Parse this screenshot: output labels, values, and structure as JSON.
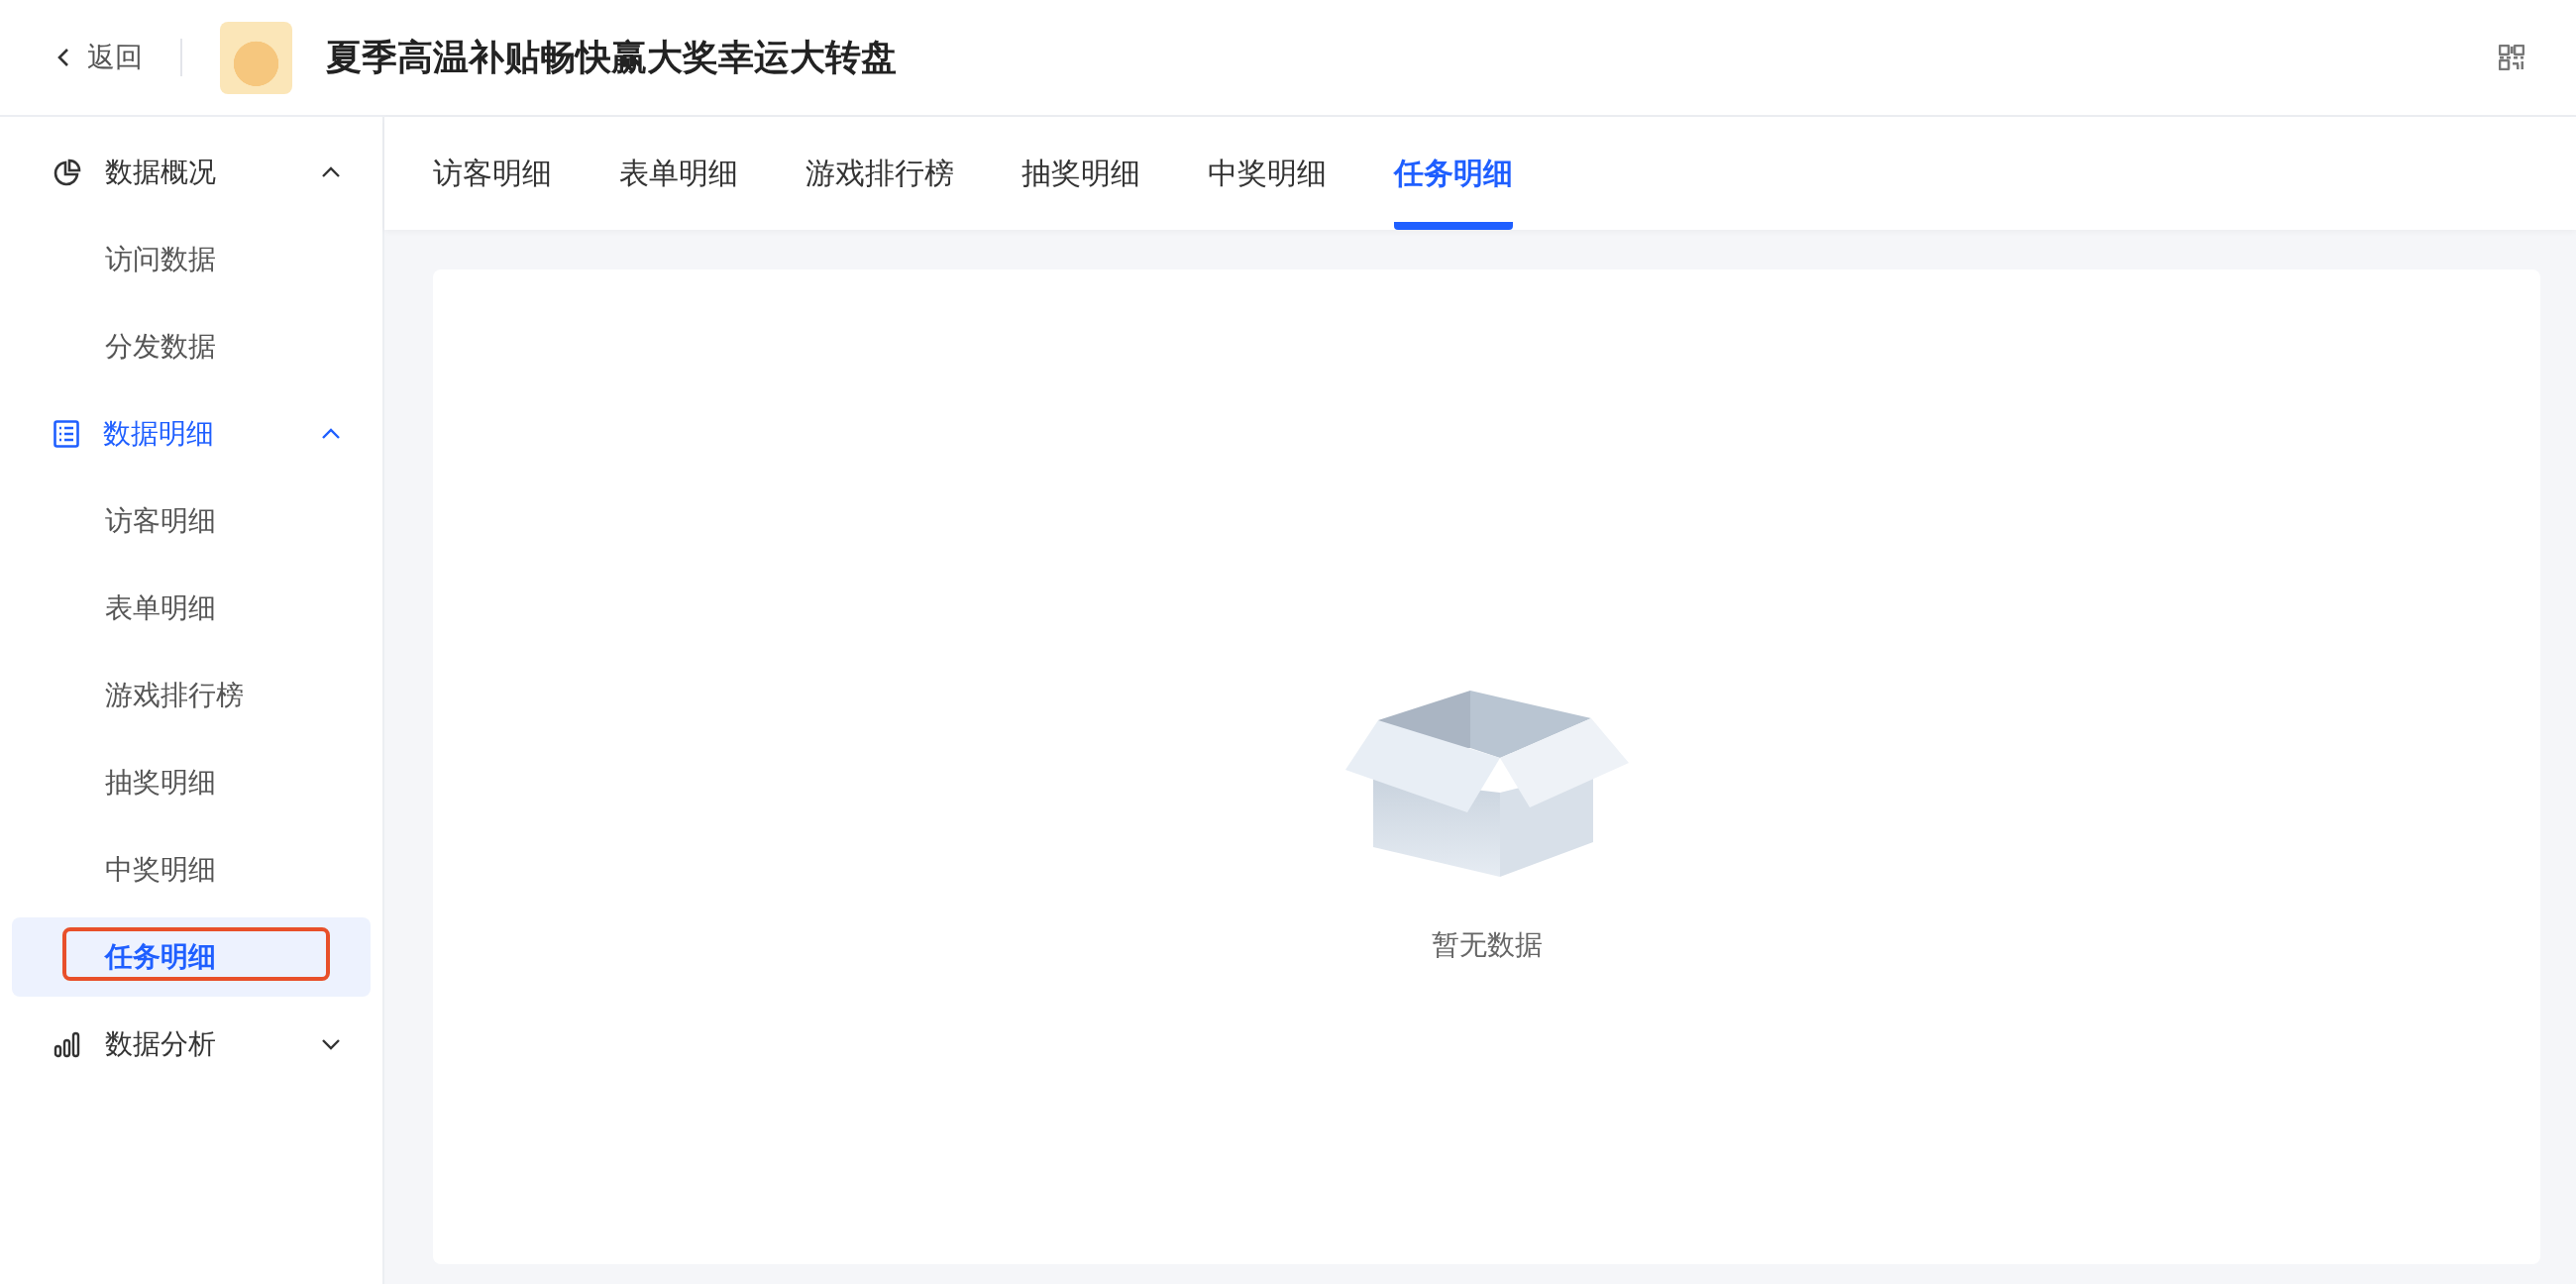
{
  "header": {
    "back_label": "返回",
    "title": "夏季高温补贴畅快赢大奖幸运大转盘"
  },
  "sidebar": {
    "groups": [
      {
        "kind": "pie",
        "label": "数据概况",
        "expanded": true,
        "selected": false,
        "children": [
          {
            "label": "访问数据",
            "selected": false,
            "annotated": false
          },
          {
            "label": "分发数据",
            "selected": false,
            "annotated": false
          }
        ]
      },
      {
        "kind": "list",
        "label": "数据明细",
        "expanded": true,
        "selected": true,
        "children": [
          {
            "label": "访客明细",
            "selected": false,
            "annotated": false
          },
          {
            "label": "表单明细",
            "selected": false,
            "annotated": false
          },
          {
            "label": "游戏排行榜",
            "selected": false,
            "annotated": false
          },
          {
            "label": "抽奖明细",
            "selected": false,
            "annotated": false
          },
          {
            "label": "中奖明细",
            "selected": false,
            "annotated": false
          },
          {
            "label": "任务明细",
            "selected": true,
            "annotated": true
          }
        ]
      },
      {
        "kind": "bars",
        "label": "数据分析",
        "expanded": false,
        "selected": false
      }
    ]
  },
  "tabs": [
    {
      "label": "访客明细",
      "selected": false
    },
    {
      "label": "表单明细",
      "selected": false
    },
    {
      "label": "游戏排行榜",
      "selected": false
    },
    {
      "label": "抽奖明细",
      "selected": false
    },
    {
      "label": "中奖明细",
      "selected": false
    },
    {
      "label": "任务明细",
      "selected": true
    }
  ],
  "empty_state": {
    "message": "暂无数据"
  }
}
